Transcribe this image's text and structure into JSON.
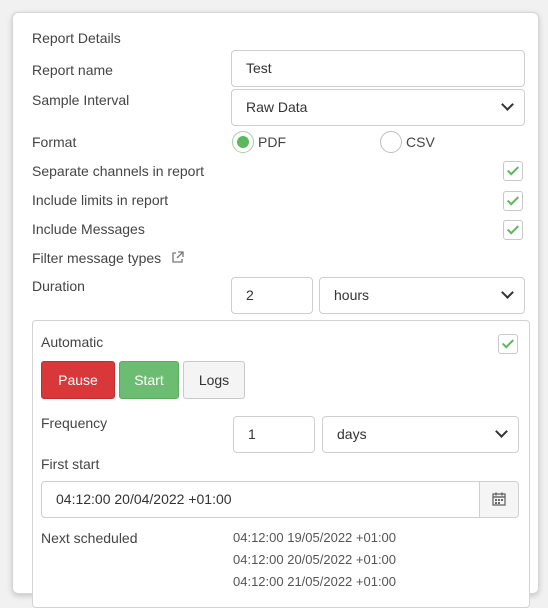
{
  "section_title": "Report Details",
  "report_name": {
    "label": "Report name",
    "value": "Test"
  },
  "sample_interval": {
    "label": "Sample Interval",
    "value": "Raw Data"
  },
  "format": {
    "label": "Format",
    "options": [
      "PDF",
      "CSV"
    ],
    "selected": "PDF"
  },
  "checks": {
    "separate_channels": {
      "label": "Separate channels in report",
      "checked": true
    },
    "include_limits": {
      "label": "Include limits in report",
      "checked": true
    },
    "include_messages": {
      "label": "Include Messages",
      "checked": true
    }
  },
  "filter_message_types": {
    "label": "Filter message types",
    "icon": "external-link-icon"
  },
  "duration": {
    "label": "Duration",
    "value": "2",
    "unit": "hours"
  },
  "automatic": {
    "label": "Automatic",
    "checked": true,
    "buttons": {
      "pause": "Pause",
      "start": "Start",
      "logs": "Logs"
    },
    "frequency": {
      "label": "Frequency",
      "value": "1",
      "unit": "days"
    },
    "first_start": {
      "label": "First start",
      "value": "04:12:00 20/04/2022 +01:00",
      "icon": "calendar-icon"
    },
    "next_scheduled": {
      "label": "Next scheduled",
      "times": [
        "04:12:00 19/05/2022 +01:00",
        "04:12:00 20/05/2022 +01:00",
        "04:12:00 21/05/2022 +01:00"
      ]
    }
  },
  "colors": {
    "danger": "#d9383a",
    "success": "#6cbd72",
    "check": "#5cb85c"
  }
}
